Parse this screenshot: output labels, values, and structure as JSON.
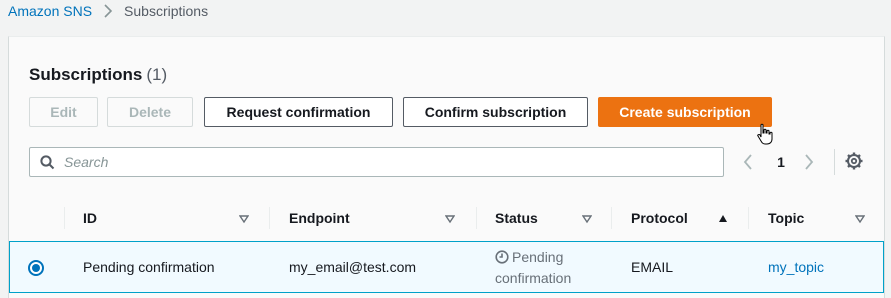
{
  "breadcrumb": {
    "root": "Amazon SNS",
    "separator_icon": "chevron-right-icon",
    "current": "Subscriptions"
  },
  "panel": {
    "title": "Subscriptions",
    "count": "(1)"
  },
  "toolbar": {
    "edit": "Edit",
    "delete": "Delete",
    "request_confirmation": "Request confirmation",
    "confirm_subscription": "Confirm subscription",
    "create_subscription": "Create subscription"
  },
  "search": {
    "placeholder": "Search",
    "value": ""
  },
  "pagination": {
    "current_page": "1"
  },
  "table": {
    "columns": [
      {
        "label": "ID",
        "sort": "none"
      },
      {
        "label": "Endpoint",
        "sort": "none"
      },
      {
        "label": "Status",
        "sort": "none"
      },
      {
        "label": "Protocol",
        "sort": "ascending"
      },
      {
        "label": "Topic",
        "sort": "none"
      }
    ],
    "rows": [
      {
        "selected": true,
        "id": "Pending confirmation",
        "endpoint": "my_email@test.com",
        "status_line1": "Pending",
        "status_line2": "confirmation",
        "protocol": "EMAIL",
        "topic": "my_topic"
      }
    ]
  },
  "colors": {
    "primary": "#ec7211",
    "link": "#0073bb",
    "selected_row_bg": "#f1faff",
    "selected_row_border": "#00a1c9"
  }
}
